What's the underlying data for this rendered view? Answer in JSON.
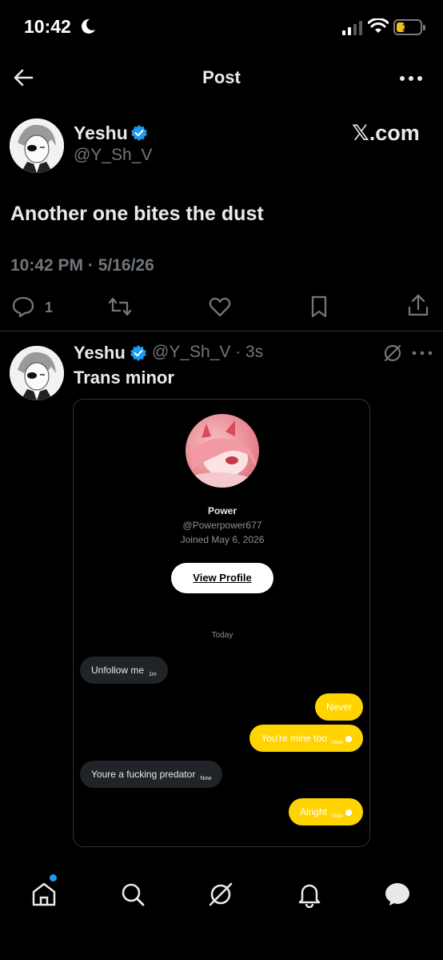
{
  "status_bar": {
    "time": "10:42",
    "battery": "19"
  },
  "header": {
    "title": "Post"
  },
  "post": {
    "author_name": "Yeshu",
    "author_handle": "@Y_Sh_V",
    "watermark": "𝕏.com",
    "text": "Another one bites the dust",
    "timestamp": "10:42 PM · 5/16/26",
    "reply_count": "1"
  },
  "reply": {
    "author_name": "Yeshu",
    "author_handle_time": "@Y_Sh_V · 3s",
    "text": "Trans minor",
    "card": {
      "profile_name": "Power",
      "profile_handle": "@Powerpower677",
      "joined": "Joined May 6, 2026",
      "view_profile_label": "View Profile",
      "day_label": "Today",
      "messages": [
        {
          "text": "Unfollow me",
          "meta": "1m",
          "direction": "in"
        },
        {
          "text": "Never",
          "meta": "",
          "direction": "out"
        },
        {
          "text": "You're mine too",
          "meta": "Now",
          "direction": "out"
        },
        {
          "text": "Youre a fucking predator",
          "meta": "Now",
          "direction": "in"
        },
        {
          "text": "Alright",
          "meta": "Now",
          "direction": "out"
        }
      ]
    }
  },
  "colors": {
    "verified": "#1d9bf0",
    "accent_yellow": "#ffd400",
    "muted": "#71767b"
  },
  "icons": [
    "back-arrow-icon",
    "more-icon",
    "verified-badge-icon",
    "reply-icon",
    "retweet-icon",
    "like-icon",
    "bookmark-icon",
    "share-icon",
    "grok-icon",
    "home-icon",
    "search-icon",
    "notifications-icon",
    "chat-icon"
  ]
}
